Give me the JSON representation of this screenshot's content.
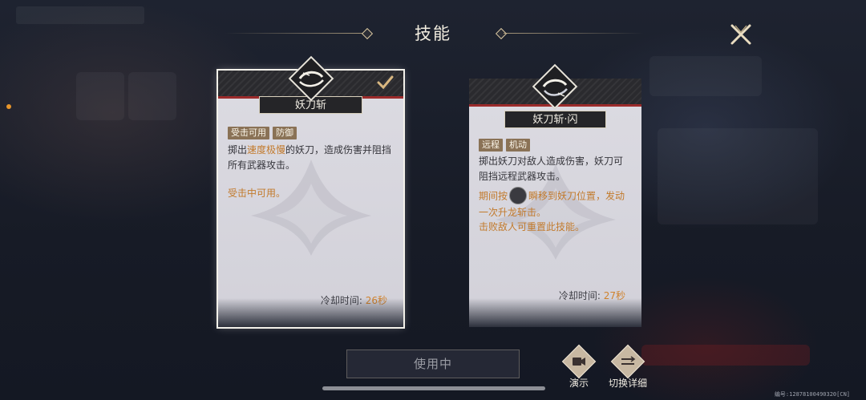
{
  "header": {
    "title": "技能"
  },
  "cards": [
    {
      "name": "妖刀斩",
      "selected": true,
      "tags": [
        "受击可用",
        "防御"
      ],
      "desc_pre": "掷出",
      "desc_hl": "速度极慢",
      "desc_post": "的妖刀，造成伤害并阻挡所有武器攻击。",
      "note": "受击中可用。",
      "cooldown_label": "冷却时间:",
      "cooldown_value": "26秒"
    },
    {
      "name": "妖刀斩·闪",
      "selected": false,
      "tags": [
        "远程",
        "机动"
      ],
      "desc": "掷出妖刀对敌人造成伤害，妖刀可阻挡远程武器攻击。",
      "note_pre": "期间按",
      "note_post": "瞬移到妖刀位置，发动一次升龙斩击。",
      "note2": "击败敌人可重置此技能。",
      "cooldown_label": "冷却时间:",
      "cooldown_value": "27秒"
    }
  ],
  "footer": {
    "use_label": "使用中",
    "demo_label": "演示",
    "switch_label": "切换详细",
    "serial": "编号:12878100490320[CN]"
  },
  "colors": {
    "accent": "#c27a2c",
    "tag": "#8a7256",
    "redline": "#9b2b2b"
  },
  "icons": [
    "close-icon",
    "blade-emblem-icon",
    "checkmark-icon",
    "video-icon",
    "switch-detail-icon"
  ]
}
